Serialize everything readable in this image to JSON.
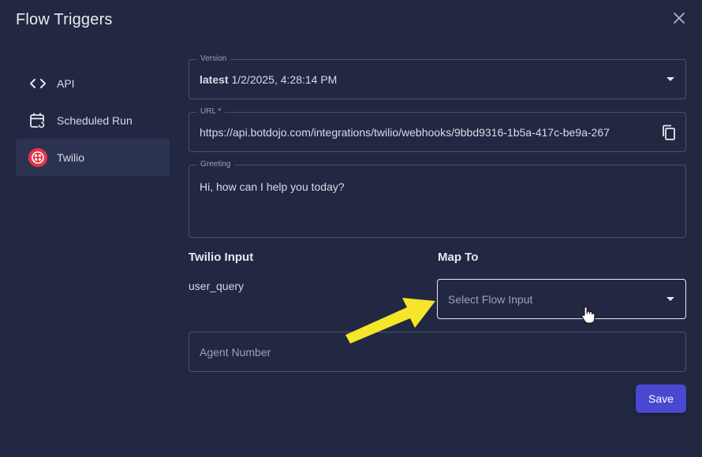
{
  "dialog": {
    "title": "Flow Triggers"
  },
  "sidebar": {
    "items": [
      {
        "label": "API",
        "icon": "code-icon"
      },
      {
        "label": "Scheduled Run",
        "icon": "calendar-refresh-icon"
      },
      {
        "label": "Twilio",
        "icon": "twilio-logo",
        "active": true
      }
    ]
  },
  "form": {
    "version": {
      "label": "Version",
      "tag": "latest",
      "value": "1/2/2025, 4:28:14 PM"
    },
    "url": {
      "label": "URL *",
      "value": "https://api.botdojo.com/integrations/twilio/webhooks/9bbd9316-1b5a-417c-be9a-267"
    },
    "greeting": {
      "label": "Greeting",
      "value": "Hi, how can I help you today?"
    },
    "mapping": {
      "col_input": "Twilio Input",
      "col_map": "Map To",
      "rows": [
        {
          "input": "user_query",
          "placeholder": "Select Flow Input"
        }
      ]
    },
    "agent_number": {
      "placeholder": "Agent Number"
    },
    "save_label": "Save"
  },
  "colors": {
    "background": "#222841",
    "accent": "#4a47d1",
    "twilio_red": "#e8344a",
    "annotation_arrow": "#f5e52b"
  }
}
